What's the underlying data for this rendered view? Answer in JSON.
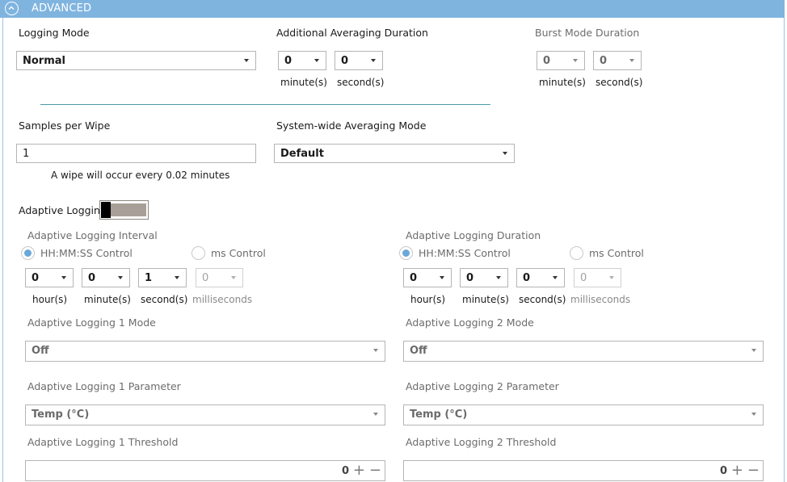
{
  "section": {
    "title": "ADVANCED"
  },
  "logging_mode": {
    "label": "Logging Mode",
    "value": "Normal"
  },
  "additional_avg": {
    "label": "Additional Averaging Duration",
    "minute_value": "0",
    "second_value": "0",
    "minute_unit": "minute(s)",
    "second_unit": "second(s)"
  },
  "burst_mode": {
    "label": "Burst Mode Duration",
    "minute_value": "0",
    "second_value": "0",
    "minute_unit": "minute(s)",
    "second_unit": "second(s)"
  },
  "samples_per_wipe": {
    "label": "Samples per Wipe",
    "value": "1",
    "note": "A wipe will occur every 0.02 minutes"
  },
  "system_avg_mode": {
    "label": "System-wide Averaging Mode",
    "value": "Default"
  },
  "adaptive_logging": {
    "label": "Adaptive Logging"
  },
  "interval": {
    "label": "Adaptive Logging Interval",
    "radio_hms": "HH:MM:SS Control",
    "radio_ms": "ms Control",
    "hour_value": "0",
    "minute_value": "0",
    "second_value": "1",
    "ms_value": "0",
    "hour_unit": "hour(s)",
    "minute_unit": "minute(s)",
    "second_unit": "second(s)",
    "ms_unit": "milliseconds"
  },
  "duration": {
    "label": "Adaptive Logging Duration",
    "radio_hms": "HH:MM:SS Control",
    "radio_ms": "ms Control",
    "hour_value": "0",
    "minute_value": "0",
    "second_value": "0",
    "ms_value": "0",
    "hour_unit": "hour(s)",
    "minute_unit": "minute(s)",
    "second_unit": "second(s)",
    "ms_unit": "milliseconds"
  },
  "al1": {
    "mode_label": "Adaptive Logging 1 Mode",
    "mode_value": "Off",
    "param_label": "Adaptive Logging 1 Parameter",
    "param_value": "Temp (°C)",
    "threshold_label": "Adaptive Logging 1 Threshold",
    "threshold_value": "0"
  },
  "al2": {
    "mode_label": "Adaptive Logging 2 Mode",
    "mode_value": "Off",
    "param_label": "Adaptive Logging 2 Parameter",
    "param_value": "Temp (°C)",
    "threshold_label": "Adaptive Logging 2 Threshold",
    "threshold_value": "0"
  },
  "stepper": {
    "plus": "+",
    "minus": "−"
  },
  "colors": {
    "header": "#7fb4df",
    "divider": "#4a9aa8",
    "radio_on": "#6aa8d8"
  }
}
